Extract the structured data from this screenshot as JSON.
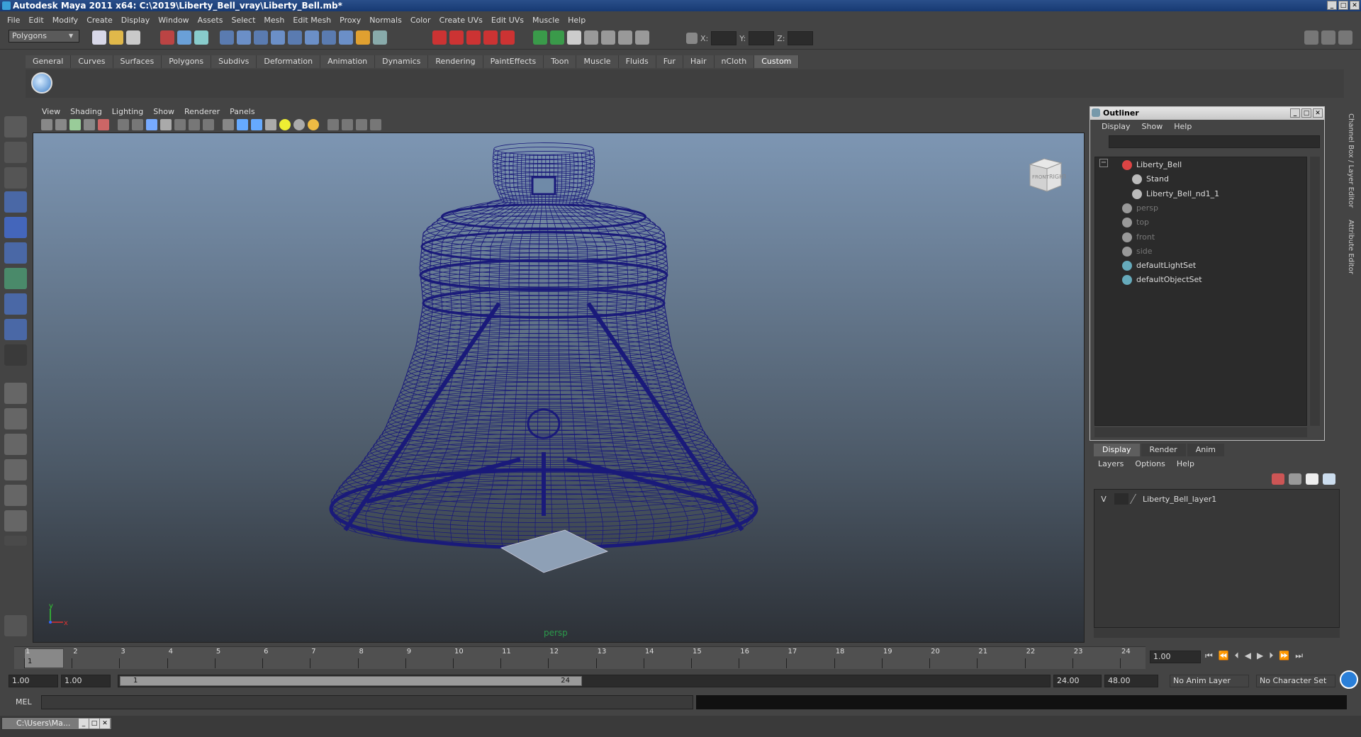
{
  "window": {
    "title": "Autodesk Maya 2011 x64: C:\\2019\\Liberty_Bell_vray\\Liberty_Bell.mb*",
    "min": "_",
    "max": "□",
    "close": "✕"
  },
  "menubar": [
    "File",
    "Edit",
    "Modify",
    "Create",
    "Display",
    "Window",
    "Assets",
    "Select",
    "Mesh",
    "Edit Mesh",
    "Proxy",
    "Normals",
    "Color",
    "Create UVs",
    "Edit UVs",
    "Muscle",
    "Help"
  ],
  "toolbar": {
    "mode": "Polygons",
    "x_label": "X:",
    "y_label": "Y:",
    "z_label": "Z:"
  },
  "shelf": {
    "tabs": [
      "General",
      "Curves",
      "Surfaces",
      "Polygons",
      "Subdivs",
      "Deformation",
      "Animation",
      "Dynamics",
      "Rendering",
      "PaintEffects",
      "Toon",
      "Muscle",
      "Fluids",
      "Fur",
      "Hair",
      "nCloth",
      "Custom"
    ],
    "active": "Custom"
  },
  "viewport": {
    "menu": [
      "View",
      "Shading",
      "Lighting",
      "Show",
      "Renderer",
      "Panels"
    ],
    "camera": "persp",
    "cube_front": "FRONT",
    "cube_right": "RIGHT",
    "axis_x": "x",
    "axis_y": "y",
    "wire_color": "#1a1a7a"
  },
  "outliner": {
    "title": "Outliner",
    "menu": [
      "Display",
      "Show",
      "Help"
    ],
    "items": [
      {
        "label": "Liberty_Bell",
        "depth": 0,
        "dim": false
      },
      {
        "label": "Stand",
        "depth": 1,
        "dim": false
      },
      {
        "label": "Liberty_Bell_nd1_1",
        "depth": 1,
        "dim": false
      },
      {
        "label": "persp",
        "depth": 0,
        "dim": true
      },
      {
        "label": "top",
        "depth": 0,
        "dim": true
      },
      {
        "label": "front",
        "depth": 0,
        "dim": true
      },
      {
        "label": "side",
        "depth": 0,
        "dim": true
      },
      {
        "label": "defaultLightSet",
        "depth": 0,
        "dim": false
      },
      {
        "label": "defaultObjectSet",
        "depth": 0,
        "dim": false
      }
    ]
  },
  "side_tabs": [
    "Channel Box / Layer Editor",
    "Attribute Editor"
  ],
  "layers": {
    "tabs": [
      "Display",
      "Render",
      "Anim"
    ],
    "active": "Display",
    "menu": [
      "Layers",
      "Options",
      "Help"
    ],
    "rows": [
      {
        "visible": "V",
        "name": "Liberty_Bell_layer1"
      }
    ]
  },
  "timeline": {
    "ticks": [
      "1",
      "2",
      "3",
      "4",
      "5",
      "6",
      "7",
      "8",
      "9",
      "10",
      "11",
      "12",
      "13",
      "14",
      "15",
      "16",
      "17",
      "18",
      "19",
      "20",
      "21",
      "22",
      "23",
      "24"
    ],
    "current": "1",
    "current_field": "1.00"
  },
  "range": {
    "start": "1.00",
    "anim_start": "1.00",
    "range_start": "1",
    "range_end": "24",
    "anim_end": "24.00",
    "end": "48.00",
    "anim_layer": "No Anim Layer",
    "char_set": "No Character Set"
  },
  "command": {
    "label": "MEL"
  },
  "taskbar": {
    "item": "C:\\Users\\Ma..."
  }
}
